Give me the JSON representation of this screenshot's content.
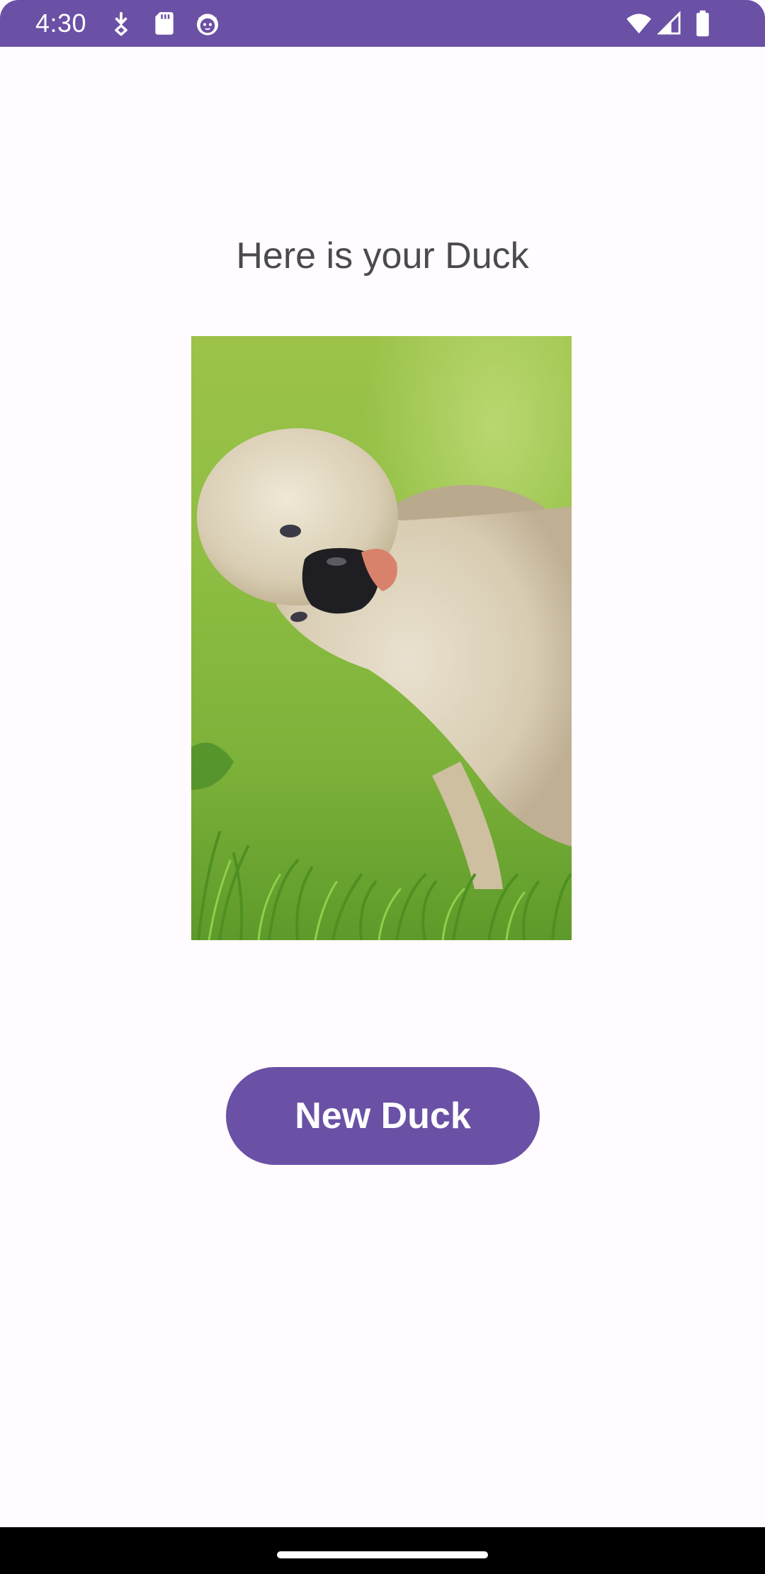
{
  "status_bar": {
    "time": "4:30",
    "left_icons": [
      "download-icon",
      "sd-card-icon",
      "cat-face-icon"
    ],
    "right_icons": [
      "wifi-icon",
      "cellular-signal-icon",
      "battery-icon"
    ],
    "background_color": "#6a51a5"
  },
  "main": {
    "heading": "Here is your Duck",
    "image": {
      "subject": "duck-photo"
    },
    "button_label": "New Duck",
    "accent_color": "#6a51a5"
  },
  "nav_bar": {
    "handle": "home-handle"
  }
}
